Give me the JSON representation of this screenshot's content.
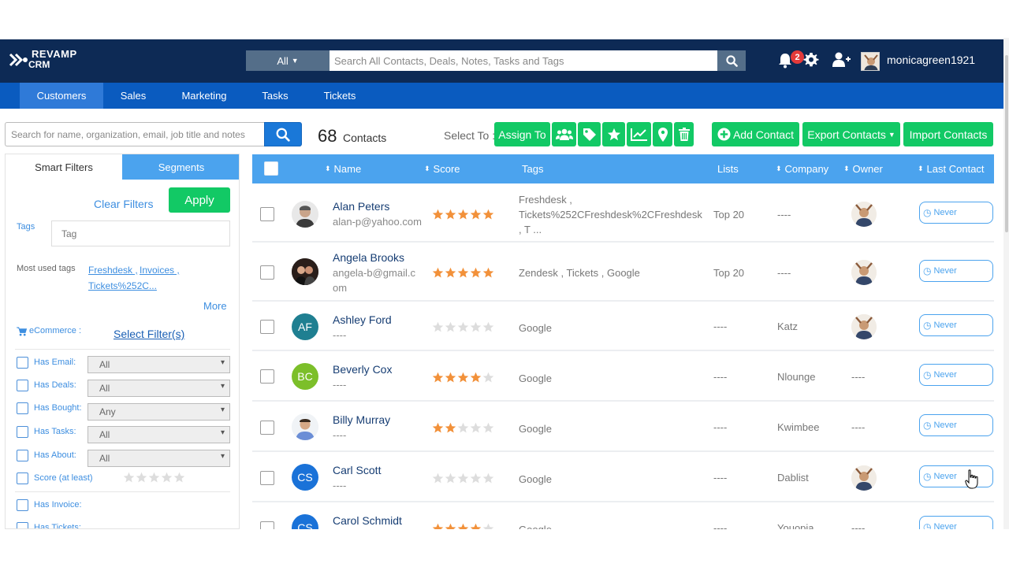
{
  "app": {
    "logo_main": "REVAMP",
    "logo_sub": "CRM"
  },
  "header": {
    "scope_label": "All",
    "search_placeholder": "Search All Contacts, Deals, Notes, Tasks and Tags",
    "notification_count": "2",
    "username": "monicagreen1921"
  },
  "nav": {
    "items": [
      "Customers",
      "Sales",
      "Marketing",
      "Tasks",
      "Tickets"
    ],
    "active": "Customers"
  },
  "toolbar": {
    "search_placeholder": "Search for name, organization, email, job title and notes",
    "contact_count": "68",
    "contact_count_label": "Contacts",
    "select_to_label": "Select To :",
    "assign_label": "Assign To",
    "add_contact_label": "Add Contact",
    "export_label": "Export Contacts",
    "import_label": "Import Contacts"
  },
  "filters": {
    "tab_smart": "Smart Filters",
    "tab_segments": "Segments",
    "clear_label": "Clear Filters",
    "apply_label": "Apply",
    "tags_label": "Tags",
    "tag_placeholder": "Tag",
    "most_used_label": "Most used tags",
    "most_used_tags": [
      "Freshdesk ,",
      "Invoices ,",
      "Tickets%252C..."
    ],
    "more_label": "More",
    "ecommerce_label": "eCommerce :",
    "select_filters_label": "Select Filter(s)",
    "rows": [
      {
        "label": "Has Email:",
        "value": "All"
      },
      {
        "label": "Has Deals:",
        "value": "All"
      },
      {
        "label": "Has Bought:",
        "value": "Any"
      },
      {
        "label": "Has Tasks:",
        "value": "All"
      },
      {
        "label": "Has About:",
        "value": "All"
      }
    ],
    "score_label": "Score (at least)",
    "invoice_label": "Has Invoice:",
    "tickets_label": "Has Tickets:"
  },
  "table": {
    "headers": {
      "name": "Name",
      "score": "Score",
      "tags": "Tags",
      "lists": "Lists",
      "company": "Company",
      "owner": "Owner",
      "last_contact": "Last Contact"
    },
    "rows": [
      {
        "name": "Alan Peters",
        "email": "alan-p@yahoo.com",
        "initials": "",
        "score": 5,
        "tags": "Freshdesk , Tickets%252CFreshdesk%2CFreshdesk , T ...",
        "lists": "Top 20",
        "company": "----",
        "owner": "avatar",
        "last_contact": "Never"
      },
      {
        "name": "Angela Brooks",
        "email": "angela-b@gmail.com",
        "initials": "",
        "score": 5,
        "tags": "Zendesk , Tickets , Google",
        "lists": "Top 20",
        "company": "----",
        "owner": "avatar",
        "last_contact": "Never"
      },
      {
        "name": "Ashley Ford",
        "email": "----",
        "initials": "AF",
        "score": 0,
        "tags": "Google",
        "lists": "----",
        "company": "Katz",
        "owner": "avatar",
        "last_contact": "Never"
      },
      {
        "name": "Beverly Cox",
        "email": "----",
        "initials": "BC",
        "score": 4,
        "tags": "Google",
        "lists": "----",
        "company": "Nlounge",
        "owner": "----",
        "last_contact": "Never"
      },
      {
        "name": "Billy Murray",
        "email": "----",
        "initials": "",
        "score": 2,
        "tags": "Google",
        "lists": "----",
        "company": "Kwimbee",
        "owner": "----",
        "last_contact": "Never"
      },
      {
        "name": "Carl Scott",
        "email": "----",
        "initials": "CS",
        "score": 0,
        "tags": "Google",
        "lists": "----",
        "company": "Dablist",
        "owner": "avatar",
        "last_contact": "Never"
      },
      {
        "name": "Carol Schmidt",
        "email": "",
        "initials": "CS",
        "score": 4,
        "tags": "Google",
        "lists": "----",
        "company": "Youopia",
        "owner": "----",
        "last_contact": "Never"
      }
    ]
  },
  "colors": {
    "topbar": "#0d2a55",
    "navbar": "#0a5bbf",
    "accent": "#4ba3ee",
    "green": "#12c965",
    "star": "#f2913a",
    "star_empty": "#dddddd",
    "avatar_teal": "#1f7f91",
    "avatar_green": "#7cbf2a",
    "avatar_blue": "#1a72d8"
  },
  "icons": {
    "search": "search-icon",
    "bell": "bell-icon",
    "gear": "gear-icon",
    "add_user": "add-user-icon",
    "clock": "clock-icon",
    "cart": "cart-icon"
  }
}
